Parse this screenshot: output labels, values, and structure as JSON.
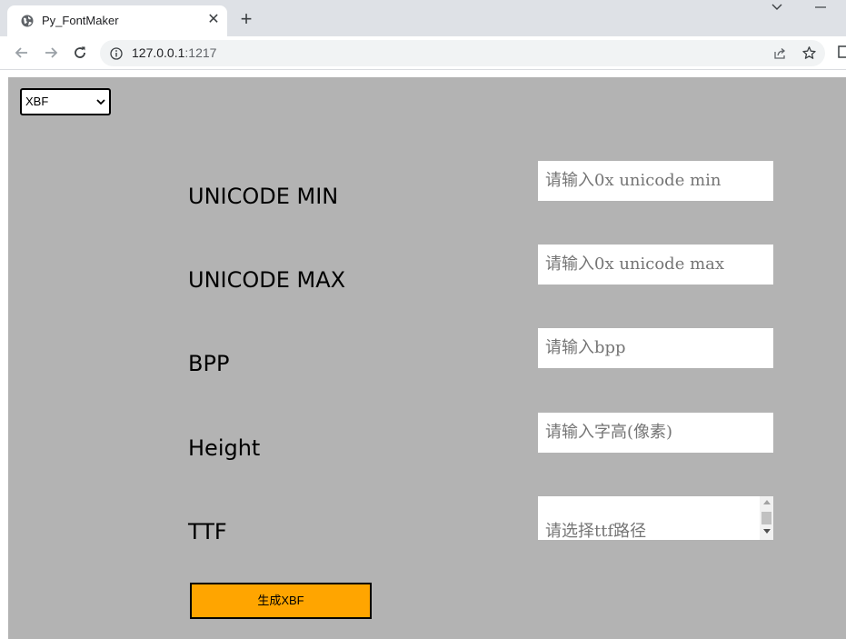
{
  "browser": {
    "tab_title": "Py_FontMaker",
    "tab_close": "✕",
    "new_tab": "+",
    "url_host": "127.0.0.1",
    "url_port": ":1217"
  },
  "form": {
    "format_select": {
      "selected": "XBF"
    },
    "fields": {
      "unicode_min": {
        "label": "UNICODE MIN",
        "placeholder": "请输入0x unicode min"
      },
      "unicode_max": {
        "label": "UNICODE MAX",
        "placeholder": "请输入0x unicode max"
      },
      "bpp": {
        "label": "BPP",
        "placeholder": "请输入bpp"
      },
      "height": {
        "label": "Height",
        "placeholder": "请输入字高(像素)"
      },
      "ttf": {
        "label": "TTF",
        "placeholder": "请选择ttf路径"
      }
    },
    "generate_label": "生成XBF"
  },
  "colors": {
    "page_bg": "#b3b3b3",
    "button_bg": "#ffa500"
  }
}
